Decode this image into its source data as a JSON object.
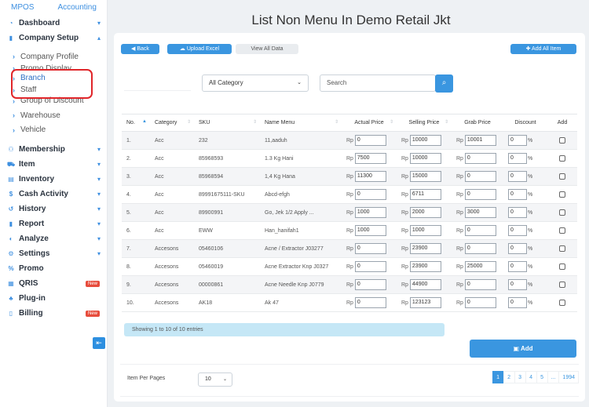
{
  "topnav": {
    "mpos": "MPOS",
    "accounting": "Accounting"
  },
  "sidebar": {
    "items": [
      {
        "label": "Dashboard",
        "icon": "dashboard-icon",
        "glyph": "◔",
        "caret": "▾"
      },
      {
        "label": "Company Setup",
        "icon": "building-icon",
        "glyph": "▮",
        "caret": "▴"
      },
      {
        "label": "Membership",
        "icon": "users-icon",
        "glyph": "⚇",
        "caret": "▾"
      },
      {
        "label": "Item",
        "icon": "cart-icon",
        "glyph": "⛟",
        "caret": "▾"
      },
      {
        "label": "Inventory",
        "icon": "inventory-icon",
        "glyph": "▤",
        "caret": "▾"
      },
      {
        "label": "Cash Activity",
        "icon": "dollar-icon",
        "glyph": "$",
        "caret": "▾"
      },
      {
        "label": "History",
        "icon": "history-icon",
        "glyph": "↺",
        "caret": "▾"
      },
      {
        "label": "Report",
        "icon": "report-icon",
        "glyph": "▮",
        "caret": "▾"
      },
      {
        "label": "Analyze",
        "icon": "analyze-icon",
        "glyph": "◐",
        "caret": "▾"
      },
      {
        "label": "Settings",
        "icon": "gear-icon",
        "glyph": "⚙",
        "caret": "▾"
      },
      {
        "label": "Promo",
        "icon": "percent-icon",
        "glyph": "%"
      },
      {
        "label": "QRIS",
        "icon": "qr-icon",
        "glyph": "▦",
        "badge": "New"
      },
      {
        "label": "Plug-in",
        "icon": "plugin-icon",
        "glyph": "♣"
      },
      {
        "label": "Billing",
        "icon": "billing-icon",
        "glyph": "▯",
        "badge": "New"
      }
    ],
    "company_sub": [
      "Company Profile",
      "Promo Display",
      "Branch",
      "Staff",
      "Group of Discount",
      "Warehouse",
      "Vehicle"
    ]
  },
  "page": {
    "title": "List Non Menu In Demo Retail Jkt"
  },
  "toolbar": {
    "back": "Back",
    "upload": "Upload Excel",
    "view_all": "View All Data",
    "add_all": "Add All Item",
    "add": "Add"
  },
  "filters": {
    "category": "All Category",
    "search_placeholder": "Search"
  },
  "table": {
    "headers": [
      "No.",
      "Category",
      "SKU",
      "Name Menu",
      "Actual Price",
      "Selling Price",
      "Grab Price",
      "Discount",
      "Add"
    ],
    "currency": "Rp",
    "percent": "%",
    "rows": [
      {
        "no": "1.",
        "category": "Acc",
        "sku": "232",
        "name": "11,aaduh",
        "actual": "0",
        "selling": "10000",
        "grab": "10001",
        "discount": "0"
      },
      {
        "no": "2.",
        "category": "Acc",
        "sku": "85968593",
        "name": "1.3 Kg Hani",
        "actual": "7500",
        "selling": "10000",
        "grab": "0",
        "discount": "0"
      },
      {
        "no": "3.",
        "category": "Acc",
        "sku": "85968594",
        "name": "1,4 Kg Hana",
        "actual": "11300",
        "selling": "15000",
        "grab": "0",
        "discount": "0"
      },
      {
        "no": "4.",
        "category": "Acc",
        "sku": "89991675111-SKU",
        "name": "Abcd-efgh",
        "actual": "0",
        "selling": "6711",
        "grab": "0",
        "discount": "0"
      },
      {
        "no": "5.",
        "category": "Acc",
        "sku": "89900991",
        "name": "Go, Jek 1/2 Apply ...",
        "actual": "1000",
        "selling": "2000",
        "grab": "3000",
        "discount": "0"
      },
      {
        "no": "6.",
        "category": "Acc",
        "sku": "EWW",
        "name": "Han_hanifah1",
        "actual": "1000",
        "selling": "1000",
        "grab": "0",
        "discount": "0"
      },
      {
        "no": "7.",
        "category": "Accesons",
        "sku": "05460106",
        "name": "Acne / Extractor J03277",
        "actual": "0",
        "selling": "23900",
        "grab": "0",
        "discount": "0"
      },
      {
        "no": "8.",
        "category": "Accesons",
        "sku": "05460019",
        "name": "Acne Extractor Knp J0327",
        "actual": "0",
        "selling": "23900",
        "grab": "25000",
        "discount": "0"
      },
      {
        "no": "9.",
        "category": "Accesons",
        "sku": "00000861",
        "name": "Acne Needle Knp J0779",
        "actual": "0",
        "selling": "44900",
        "grab": "0",
        "discount": "0"
      },
      {
        "no": "10.",
        "category": "Accesons",
        "sku": "AK18",
        "name": "Ak 47",
        "actual": "0",
        "selling": "123123",
        "grab": "0",
        "discount": "0"
      }
    ]
  },
  "info": "Showing 1 to 10 of 10 entries",
  "footer": {
    "per_page_label": "Item Per Pages",
    "per_page_value": "10"
  },
  "pagination": [
    "1",
    "2",
    "3",
    "4",
    "5",
    "...",
    "1994"
  ],
  "colors": {
    "accent": "#3a96e0",
    "highlight": "#e0262a",
    "badge": "#e74c3c"
  }
}
